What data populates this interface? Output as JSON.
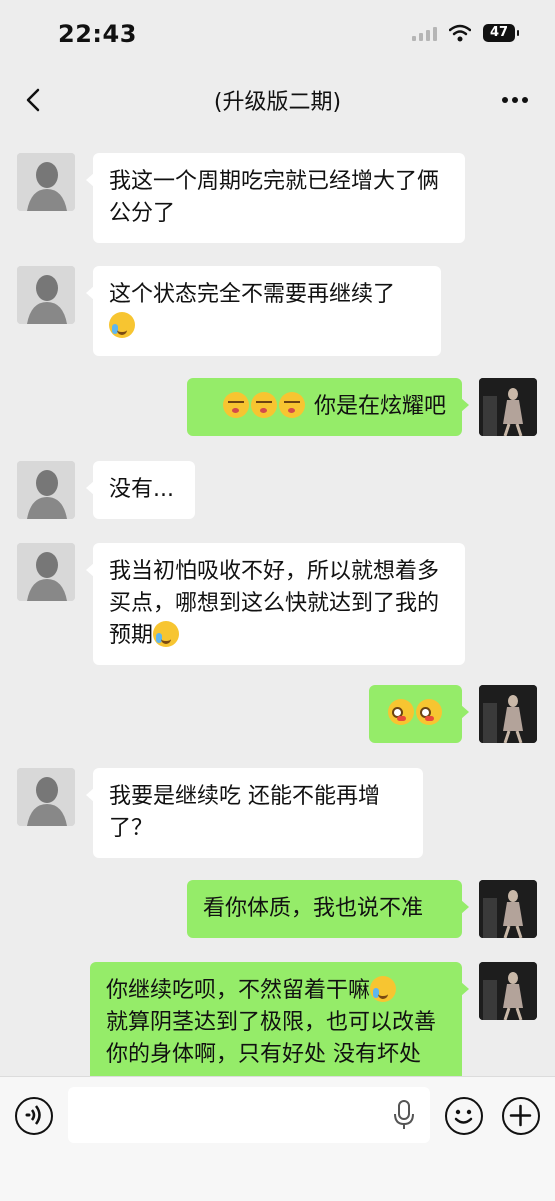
{
  "status_bar": {
    "time": "22:43",
    "battery": "47"
  },
  "nav": {
    "title": "(升级版二期)"
  },
  "messages": [
    {
      "side": "left",
      "text": "我这一个周期吃完就已经增大了俩公分了"
    },
    {
      "side": "left",
      "text": "这个状态完全不需要再继续了",
      "emoji": [
        "crying-laughing"
      ]
    },
    {
      "side": "right",
      "emoji": [
        "kissing-face",
        "kissing-face",
        "kissing-face"
      ],
      "text": "你是在炫耀吧"
    },
    {
      "side": "left",
      "text": "没有..."
    },
    {
      "side": "left",
      "text": "我当初怕吸收不好，所以就想着多买点，哪想到这么快就达到了我的预期",
      "emoji": [
        "crying-laughing"
      ]
    },
    {
      "side": "right",
      "emoji": [
        "blushing-face",
        "blushing-face"
      ]
    },
    {
      "side": "left",
      "text": "我要是继续吃 还能不能再增了？"
    },
    {
      "side": "right",
      "text": "看你体质，我也说不准"
    },
    {
      "side": "right",
      "text": "你继续吃呗，不然留着干嘛",
      "emoji": [
        "crying-laughing"
      ],
      "text2": "就算阴茎达到了极限，也可以改善你的身体啊，只有好处 没有坏处"
    }
  ],
  "input": {
    "placeholder": ""
  },
  "icons": {
    "back": "chevron-left-icon",
    "more": "more-dots-icon",
    "voice": "voice-icon",
    "mic": "microphone-icon",
    "emoji": "emoji-icon",
    "plus": "plus-icon"
  },
  "colors": {
    "background": "#ededed",
    "bubble_left": "#ffffff",
    "bubble_right": "#95ec69"
  }
}
